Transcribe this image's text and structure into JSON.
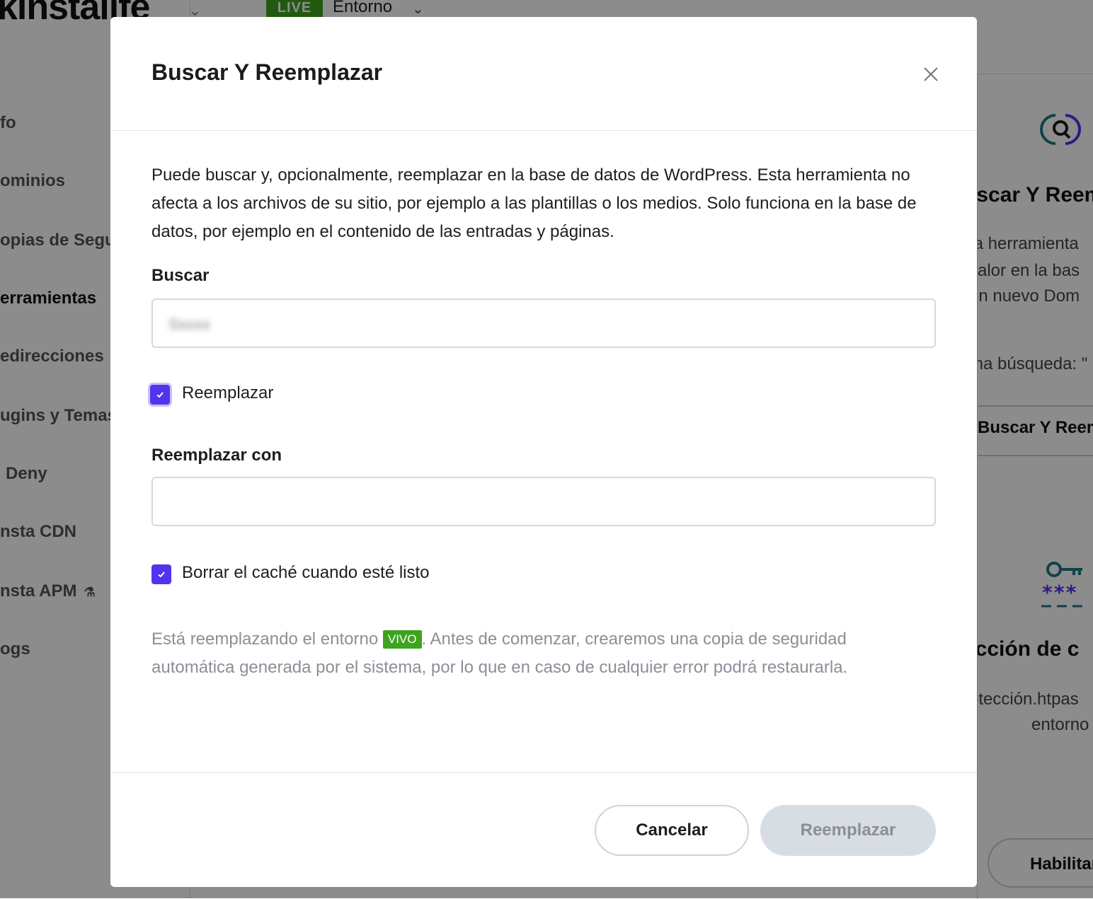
{
  "background": {
    "logo": "kinstalife",
    "env_badge": "LIVE",
    "env_label": "Entorno",
    "sidebar": [
      {
        "label": "fo"
      },
      {
        "label": "ominios"
      },
      {
        "label": "opias de Segur"
      },
      {
        "label": "erramientas"
      },
      {
        "label": "edirecciones"
      },
      {
        "label": "ugins y Temas"
      },
      {
        "label": "Deny"
      },
      {
        "label": "nsta CDN"
      },
      {
        "label": "nsta APM"
      },
      {
        "label": "ogs"
      }
    ],
    "right_panel": {
      "card1_title": "uscar Y Reem",
      "card1_line1": "ta herramienta",
      "card1_line2": "valor en la bas",
      "card1_line3": "un nuevo Dom",
      "card1_last_search": "ma búsqueda: \"",
      "card1_button": "Buscar Y Reem",
      "card2_title": "ección de c",
      "card2_line1": "otección.htpas",
      "card2_line2": "entorno",
      "card2_button": "Habilitar"
    }
  },
  "modal": {
    "title": "Buscar Y Reemplazar",
    "description": "Puede buscar y, opcionalmente, reemplazar en la base de datos de WordPress. Esta herramienta no afecta a los archivos de su sitio, por ejemplo a las plantillas o los medios. Solo funciona en la base de datos, por ejemplo en el contenido de las entradas y páginas.",
    "search_label": "Buscar",
    "search_value": "",
    "replace_checkbox_label": "Reemplazar",
    "replace_checked": true,
    "replace_with_label": "Reemplazar con",
    "replace_with_value": "",
    "clear_cache_label": "Borrar el caché cuando esté listo",
    "clear_cache_checked": true,
    "notice_before": "Está reemplazando el entorno",
    "notice_badge": "VIVO",
    "notice_after": ". Antes de comenzar, crearemos una copia de seguridad automática generada por el sistema, por lo que en caso de cualquier error podrá restaurarla.",
    "cancel_label": "Cancelar",
    "submit_label": "Reemplazar"
  },
  "colors": {
    "accent": "#5333ed",
    "live_green": "#3ea31e",
    "disabled_button": "#d8dce3",
    "overlay": "rgba(0,0,0,0.45)"
  }
}
